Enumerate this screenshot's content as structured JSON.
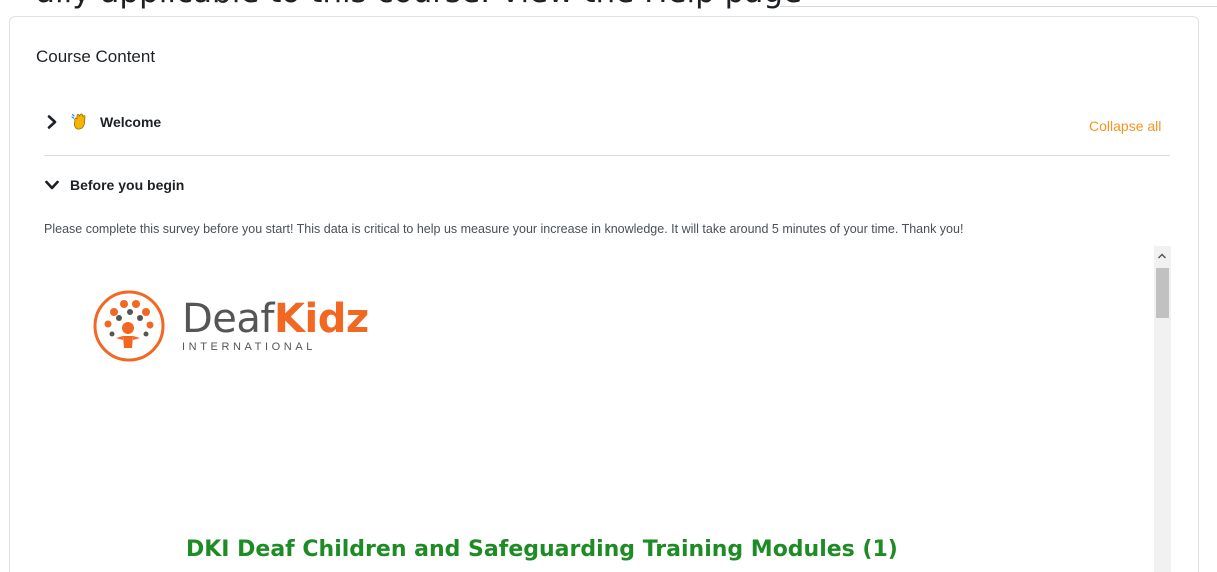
{
  "top_text": "ally applicable to this course. View the Help page",
  "card": {
    "title": "Course Content"
  },
  "sections": [
    {
      "label": "Welcome",
      "state": "collapsed"
    },
    {
      "label": "Before you begin",
      "state": "expanded"
    }
  ],
  "collapse_all": "Collapse all",
  "intro": "Please complete this survey before you start! This data is critical to help us measure your increase in knowledge. It will take around 5 minutes of your time. Thank you!",
  "embed": {
    "logo_word_a": "Deaf",
    "logo_word_b": "Kidz",
    "logo_sub": "INTERNATIONAL",
    "survey_title": "DKI Deaf Children and Safeguarding Training Modules (1)"
  },
  "colors": {
    "accent_orange": "#f7931e",
    "logo_orange": "#f26722",
    "title_green": "#1e8c25"
  },
  "icons": {
    "collapsed": "chevron-right-icon",
    "expanded": "chevron-down-icon",
    "welcome": "waving-hand-icon"
  }
}
